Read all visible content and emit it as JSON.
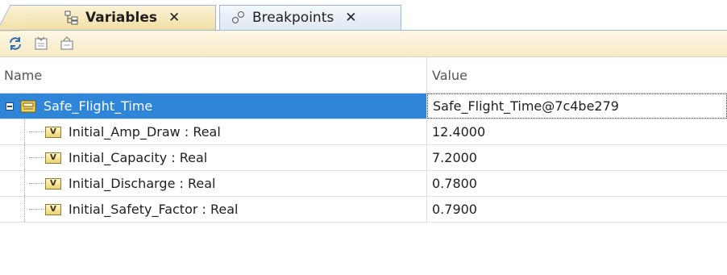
{
  "tabs": [
    {
      "label": "Variables",
      "icon": "variables-tree-icon",
      "active": true,
      "close": "✕"
    },
    {
      "label": "Breakpoints",
      "icon": "breakpoints-icon",
      "active": false,
      "close": "✕"
    }
  ],
  "toolbar": {
    "buttons": [
      "refresh-icon",
      "expand-all-icon",
      "collapse-all-icon"
    ]
  },
  "table": {
    "columns": [
      "Name",
      "Value"
    ],
    "rows": [
      {
        "name": "Safe_Flight_Time",
        "value": "Safe_Flight_Time@7c4be279",
        "type": "object",
        "selected": true
      },
      {
        "name": "Initial_Amp_Draw : Real",
        "value": "12.4000",
        "type": "variable"
      },
      {
        "name": "Initial_Capacity : Real",
        "value": "7.2000",
        "type": "variable"
      },
      {
        "name": "Initial_Discharge : Real",
        "value": "0.7800",
        "type": "variable"
      },
      {
        "name": "Initial_Safety_Factor : Real",
        "value": "0.7900",
        "type": "variable"
      }
    ]
  },
  "colors": {
    "selection": "#2f86d8",
    "toolbar_bg": "#f6ebc6",
    "active_tab": "#f3dfa5"
  }
}
